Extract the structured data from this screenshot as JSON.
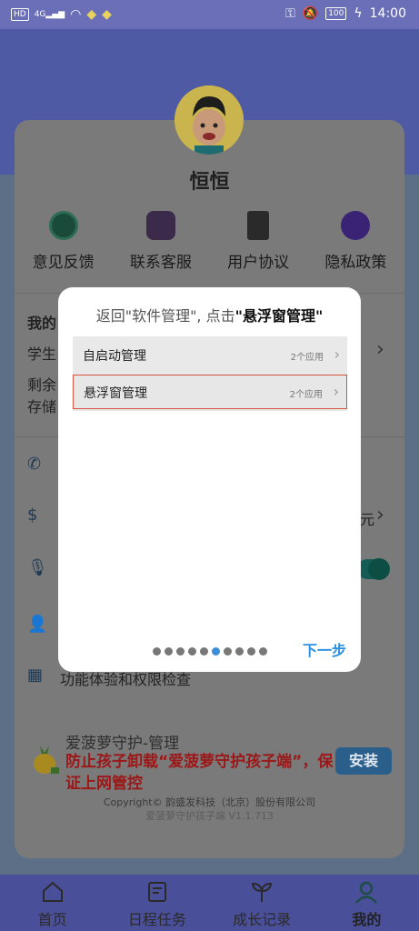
{
  "status": {
    "time": "14:00",
    "battery": "100",
    "hd": "HD",
    "signal": "4G"
  },
  "profile": {
    "name": "恒恒"
  },
  "quick": [
    {
      "label": "意见反馈",
      "icon": "feedback-icon"
    },
    {
      "label": "联系客服",
      "icon": "customer-service-icon"
    },
    {
      "label": "用户协议",
      "icon": "agreement-icon"
    },
    {
      "label": "隐私政策",
      "icon": "privacy-icon"
    }
  ],
  "background": {
    "my_label": "我的",
    "student_label": "学生",
    "remain_label": "剩余",
    "storage_label": "存储",
    "yuan_label": "元",
    "function_check": "功能体验和权限检查"
  },
  "promo": {
    "title": "爱菠萝守护-管理",
    "red_text": "防止孩子卸载“爱菠萝守护孩子端”，保证上网管控",
    "install_label": "安装",
    "copyright": "Copyright© 韵盛发科技（北京）股份有限公司",
    "version": "爱菠萝守护孩子端 V1.1.713"
  },
  "tabs": [
    {
      "label": "首页"
    },
    {
      "label": "日程任务"
    },
    {
      "label": "成长记录"
    },
    {
      "label": "我的"
    }
  ],
  "dialog": {
    "title_prefix": "返回\"软件管理\", 点击",
    "title_bold": "\"悬浮窗管理\"",
    "rows": [
      {
        "label": "自启动管理",
        "count": "2个应用"
      },
      {
        "label": "悬浮窗管理",
        "count": "2个应用"
      }
    ],
    "next_label": "下一步",
    "pages_total": 10,
    "page_active": 6
  }
}
